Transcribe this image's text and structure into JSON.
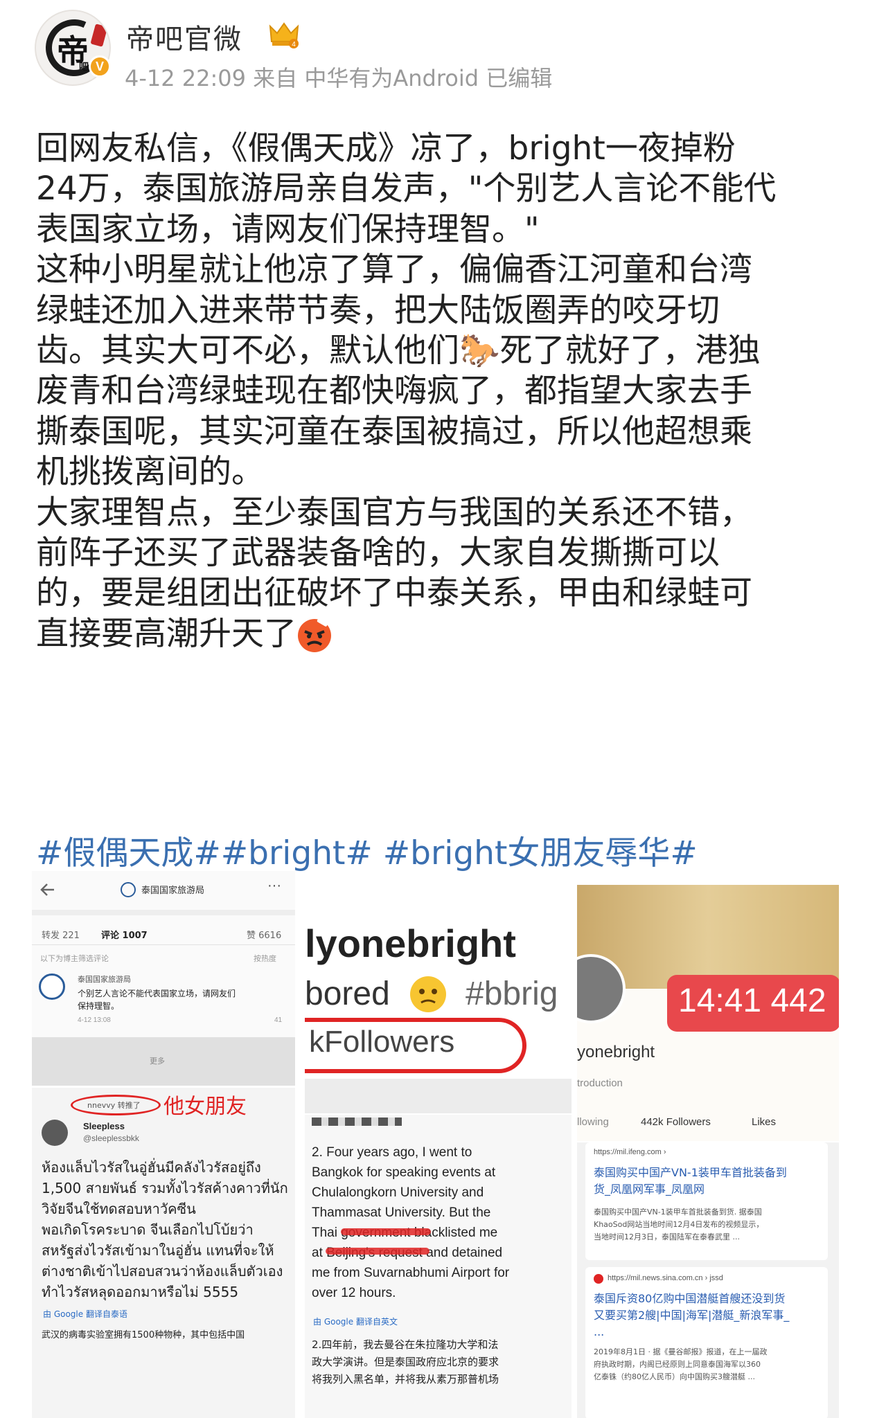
{
  "header": {
    "avatar_text": "帝",
    "avatar_sub": "吧",
    "verified_mark": "V",
    "username": "帝吧官微",
    "crown_level": "4",
    "meta": "4-12 22:09 来自 中华有为Android 已编辑"
  },
  "post": {
    "lines": [
      "回网友私信，《假偶天成》凉了，bright一夜掉粉",
      "24万，泰国旅游局亲自发声，\"个别艺人言论不能代",
      "表国家立场，请网友们保持理智。\"",
      "这种小明星就让他凉了算了，偏偏香江河童和台湾",
      "绿蛙还加入进来带节奏，把大陆饭圈弄的咬牙切",
      "齿。其实大可不必，默认他们🐎死了就好了，港独",
      "废青和台湾绿蛙现在都快嗨疯了，都指望大家去手",
      "撕泰国呢，其实河童在泰国被搞过，所以他超想乘",
      "机挑拨离间的。",
      "大家理智点，至少泰国官方与我国的关系还不错，",
      "前阵子还买了武器装备啥的，大家自发撕撕可以",
      "的，要是组团出征破坏了中泰关系，甲由和绿蛙可",
      "直接要高潮升天了"
    ],
    "hashtags": [
      "#假偶天成#",
      "#bright#",
      " #bright女朋友辱华#"
    ]
  },
  "collage": {
    "p1": {
      "title": "泰国国家旅游局",
      "more": "···",
      "reposts": "转发 221",
      "comments": "评论 1007",
      "likes": "赞 6616",
      "filter_note": "以下为博主筛选评论",
      "sort": "按热度",
      "comment_user": "泰国国家旅游局",
      "comment_text1": "个别艺人言论不能代表国家立场，请网友们",
      "comment_text2": "保持理智。",
      "comment_time": "4-12 13:08",
      "comment_likes": "41",
      "more_label": "更多",
      "repost_tag": "nnevvy 转推了",
      "annotation": "他女朋友",
      "tweet_name": "Sleepless",
      "tweet_handle": "@sleeplessbkk",
      "thai_lines": [
        "ห้องแล็บไวรัสในอู่ฮั่นมีคลังไวรัสอยู่ถึง",
        "1,500 สายพันธ์ รวมทั้งไวรัสค้างคาวที่นัก",
        "วิจัยจีนใช้ทดสอบหาวัคซีน",
        "พอเกิดโรคระบาด จีนเลือกไปโบ้ยว่า",
        "สหรัฐส่งไวรัสเข้ามาในอู่ฮั่น แทนที่จะให้",
        "ต่างชาติเข้าไปสอบสวนว่าห้องแล็บตัวเอง",
        "ทำไวรัสหลุดออกมาหรือไม่ 5555"
      ],
      "translate": "由 Google 翻译自泰语",
      "cn_line": "武汉的病毒实验室拥有1500种物种，其中包括中国"
    },
    "p2": {
      "line1": "lyonebright",
      "line2": "bored",
      "line2b": "#bbrig",
      "line3": "kFollowers",
      "en_lines": [
        "2. Four years ago, I went to",
        "Bangkok for speaking events at",
        "Chulalongkorn University and",
        "Thammasat University. But the",
        "Thai government blacklisted me",
        "at Beijing's request and detained",
        "me from Suvarnabhumi Airport for",
        "over 12 hours."
      ],
      "translate": "由 Google 翻译自英文",
      "cn_lines": [
        "2.四年前，我去曼谷在朱拉隆功大学和法",
        "政大学演讲。但是泰国政府应北京的要求",
        "将我列入黑名单，并将我从素万那普机场"
      ]
    },
    "p3": {
      "clock": "14:41 442",
      "name": "yonebright",
      "intro": "troduction",
      "following": "llowing",
      "followers": "442k Followers",
      "likes": "Likes",
      "card1_url": "https://mil.ifeng.com ›",
      "card1_title1": "泰国购买中国产VN-1装甲车首批装备到",
      "card1_title2": "货_凤凰网军事_凤凰网",
      "card1_body": [
        "泰国购买中国产VN-1装甲车首批装备到货. 据泰国",
        "KhaoSod网站当地时间12月4日发布的视频显示，",
        "当地时间12月3日，泰国陆军在泰春武里 ..."
      ],
      "card2_url": "https://mil.news.sina.com.cn › jssd",
      "card2_title1": "泰国斥资80亿购中国潜艇首艘还没到货",
      "card2_title2": "又要买第2艘|中国|海军|潜艇_新浪军事_",
      "card2_ellipsis": "...",
      "card2_body": [
        "2019年8月1日 · 据《曼谷邮报》报道，在上一届政",
        "府执政时期，内阁已经原则上同意泰国海军以360",
        "亿泰铢（约80亿人民币）向中国购买3艘潜艇 ..."
      ]
    }
  },
  "colors": {
    "hashtag": "#3a6fb0",
    "meta_gray": "#9a9a9a",
    "badge_orange": "#f2a21c",
    "red_markup": "#e02424"
  }
}
